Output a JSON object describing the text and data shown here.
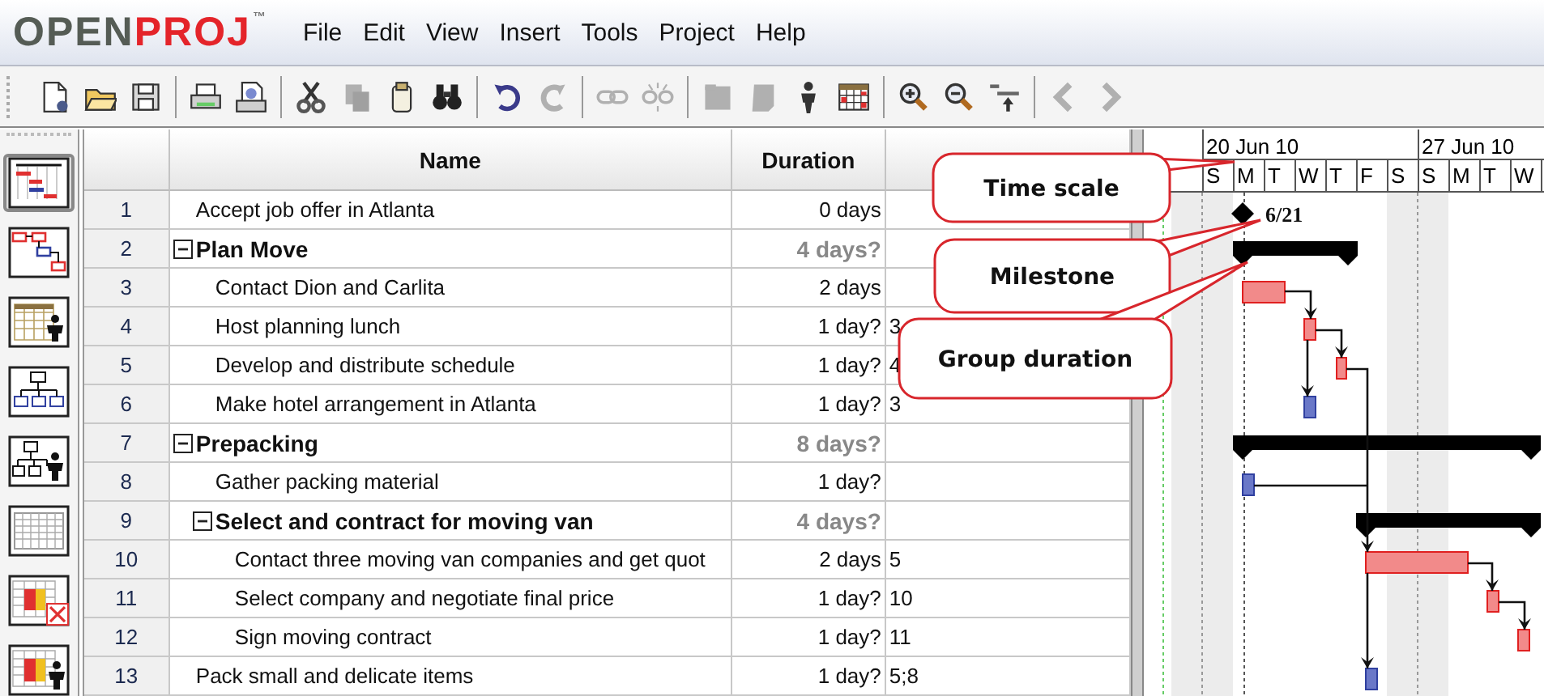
{
  "app": {
    "logo": [
      "OPEN",
      "PROJ",
      "™"
    ]
  },
  "menu": [
    "File",
    "Edit",
    "View",
    "Insert",
    "Tools",
    "Project",
    "Help"
  ],
  "toolbar": [
    {
      "kind": "new",
      "disabled": false
    },
    {
      "kind": "open",
      "disabled": false
    },
    {
      "kind": "save",
      "disabled": false
    },
    {
      "kind": "separator"
    },
    {
      "kind": "print",
      "disabled": false
    },
    {
      "kind": "preview",
      "disabled": false
    },
    {
      "kind": "separator"
    },
    {
      "kind": "cut",
      "disabled": false
    },
    {
      "kind": "copy",
      "disabled": true
    },
    {
      "kind": "paste",
      "disabled": false
    },
    {
      "kind": "find",
      "disabled": false
    },
    {
      "kind": "separator"
    },
    {
      "kind": "undo",
      "disabled": false
    },
    {
      "kind": "redo",
      "disabled": true
    },
    {
      "kind": "separator"
    },
    {
      "kind": "link",
      "disabled": true
    },
    {
      "kind": "unlink",
      "disabled": true
    },
    {
      "kind": "separator"
    },
    {
      "kind": "info",
      "disabled": true
    },
    {
      "kind": "notes",
      "disabled": true
    },
    {
      "kind": "person",
      "disabled": false
    },
    {
      "kind": "calendar",
      "disabled": false
    },
    {
      "kind": "separator"
    },
    {
      "kind": "zoomin",
      "disabled": false
    },
    {
      "kind": "zoomout",
      "disabled": false
    },
    {
      "kind": "scroll",
      "disabled": false
    },
    {
      "kind": "separator"
    },
    {
      "kind": "back",
      "disabled": true
    },
    {
      "kind": "forward",
      "disabled": true
    }
  ],
  "views": [
    {
      "kind": "gantt",
      "selected": true
    },
    {
      "kind": "network",
      "selected": false
    },
    {
      "kind": "resources",
      "selected": false
    },
    {
      "kind": "wbs",
      "selected": false
    },
    {
      "kind": "rbs",
      "selected": false
    },
    {
      "kind": "sheet",
      "selected": false
    },
    {
      "kind": "task_usage",
      "selected": false
    },
    {
      "kind": "resource_usage",
      "selected": false
    }
  ],
  "table": {
    "columns": [
      {
        "label": "Name"
      },
      {
        "label": "Duration"
      }
    ],
    "rows": [
      {
        "id": "1",
        "name": "Accept job offer in Atlanta",
        "duration": "0 days",
        "kind": "task"
      },
      {
        "id": "2",
        "name": "Plan Move",
        "duration": "4 days?",
        "kind": "summary",
        "expanded": true,
        "children": [
          {
            "id": "3",
            "name": "Contact Dion and Carlita",
            "duration": "2 days",
            "kind": "task"
          },
          {
            "id": "4",
            "name": "Host planning  lunch",
            "duration": "1 day?",
            "column_3": "3",
            "kind": "task"
          },
          {
            "id": "5",
            "name": "Develop and distribute schedule",
            "duration": "1 day?",
            "column_3": "4",
            "kind": "task"
          },
          {
            "id": "6",
            "name": "Make hotel arrangement in Atlanta",
            "duration": "1 day?",
            "column_3": "3",
            "kind": "task"
          }
        ]
      },
      {
        "id": "7",
        "name": "Prepacking",
        "duration": "8 days?",
        "kind": "summary",
        "expanded": true,
        "children": [
          {
            "id": "8",
            "name": "Gather packing material",
            "duration": "1 day?",
            "kind": "task"
          },
          {
            "id": "9",
            "name": "Select and contract for moving van",
            "duration": "4 days?",
            "kind": "summary",
            "expanded": true,
            "children": [
              {
                "id": "10",
                "name": "Contact three moving van companies and get quot",
                "duration": "2 days",
                "column_3": "5",
                "kind": "task"
              },
              {
                "id": "11",
                "name": "Select company and negotiate final price",
                "duration": "1 day?",
                "column_3": "10",
                "kind": "task"
              },
              {
                "id": "12",
                "name": "Sign moving contract",
                "duration": "1 day?",
                "column_3": "11",
                "kind": "task"
              }
            ]
          }
        ]
      },
      {
        "id": "13",
        "name": "Pack small and delicate items",
        "duration": "1 day?",
        "column_3": "5;8",
        "kind": "task"
      }
    ]
  },
  "gantt": {
    "weeks": [
      "20 Jun 10",
      "27 Jun 10"
    ],
    "days": [
      "S",
      "M",
      "T",
      "W",
      "T",
      "F",
      "S",
      "S",
      "M",
      "T",
      "W"
    ],
    "milestone_label": "6/21"
  },
  "callouts": [
    {
      "label": "Time scale"
    },
    {
      "label": "Milestone"
    },
    {
      "label": "Group duration"
    }
  ]
}
